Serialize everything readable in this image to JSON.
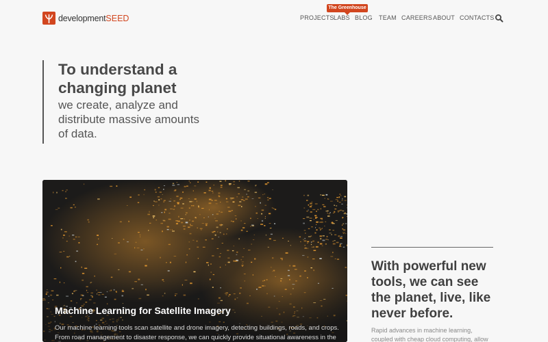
{
  "header": {
    "logo_text": "development",
    "logo_accent": "SEED",
    "nav": [
      {
        "label": "PROJECTS"
      },
      {
        "label": "LABS"
      },
      {
        "label": "BLOG"
      },
      {
        "label": "TEAM"
      },
      {
        "label": "CAREERS"
      },
      {
        "label": "ABOUT"
      },
      {
        "label": "CONTACTS"
      }
    ],
    "labs_badge": "The Greenhouse",
    "search_icon": "search-icon"
  },
  "hero": {
    "title": "To understand a changing planet",
    "subtitle": "we create, analyze and distribute massive amounts of data."
  },
  "feature": {
    "title": "Machine Learning for Satellite Imagery",
    "text": "Our machine learning tools scan satellite and drone imagery, detecting buildings, roads, and crops. From road management to disaster response, we can quickly provide situational awareness in the"
  },
  "side": {
    "title": "With powerful new tools, we can see the planet, live, like never before.",
    "text": "Rapid advances in machine learning, coupled with cheap cloud computing, allow"
  },
  "colors": {
    "brand": "#d2461f",
    "text_dark": "#444444",
    "background": "#f7f7f7"
  }
}
